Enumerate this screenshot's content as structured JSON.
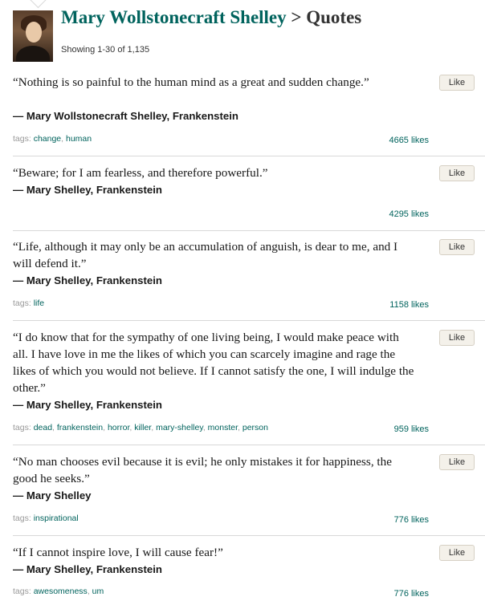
{
  "header": {
    "author": "Mary Wollstonecraft Shelley",
    "separator": ">",
    "section": "Quotes",
    "showing": "Showing 1-30 of 1,135"
  },
  "tags_label": "tags:",
  "like_label": "Like",
  "quotes": [
    {
      "text": "“Nothing is so painful to the human mind as a great and sudden change.”",
      "attribution": "― Mary Wollstonecraft Shelley, Frankenstein",
      "tags": [
        "change",
        "human"
      ],
      "likes": "4665 likes"
    },
    {
      "text": "“Beware; for I am fearless, and therefore powerful.”",
      "attribution": "― Mary Shelley, Frankenstein",
      "tags": [],
      "likes": "4295 likes"
    },
    {
      "text": "“Life, although it may only be an accumulation of anguish, is dear to me, and I will defend it.”",
      "attribution": "― Mary Shelley, Frankenstein",
      "tags": [
        "life"
      ],
      "likes": "1158 likes"
    },
    {
      "text": "“I do know that for the sympathy of one living being, I would make peace with all. I have love in me the likes of which you can scarcely imagine and rage the likes of which you would not believe. If I cannot satisfy the one, I will indulge the other.”",
      "attribution": "― Mary Shelley, Frankenstein",
      "tags": [
        "dead",
        "frankenstein",
        "horror",
        "killer",
        "mary-shelley",
        "monster",
        "person"
      ],
      "likes": "959 likes"
    },
    {
      "text": "“No man chooses evil because it is evil; he only mistakes it for happiness, the good he seeks.”",
      "attribution": "― Mary Shelley",
      "tags": [
        "inspirational"
      ],
      "likes": "776 likes"
    },
    {
      "text": "“If I cannot inspire love, I will cause fear!”",
      "attribution": "― Mary Shelley, Frankenstein",
      "tags": [
        "awesomeness",
        "um"
      ],
      "likes": "776 likes"
    }
  ]
}
